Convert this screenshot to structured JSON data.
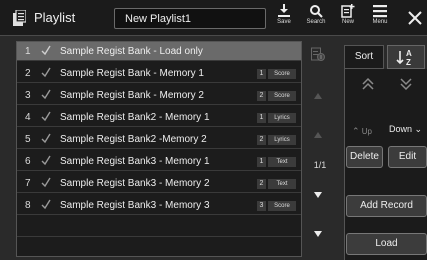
{
  "header": {
    "title": "Playlist",
    "playlist_name": "New Playlist1",
    "tools": [
      {
        "label": "Save",
        "icon": "save-icon"
      },
      {
        "label": "Search",
        "icon": "search-icon"
      },
      {
        "label": "New",
        "icon": "new-icon"
      },
      {
        "label": "Menu",
        "icon": "menu-icon"
      }
    ]
  },
  "list": {
    "rows": [
      {
        "num": "1",
        "name": "Sample Regist Bank - Load only",
        "memory": "",
        "type": ""
      },
      {
        "num": "2",
        "name": "Sample Regist Bank - Memory 1",
        "memory": "1",
        "type": "Score"
      },
      {
        "num": "3",
        "name": "Sample Regist Bank - Memory 2",
        "memory": "2",
        "type": "Score"
      },
      {
        "num": "4",
        "name": "Sample Regist Bank2 - Memory 1",
        "memory": "1",
        "type": "Lyrics"
      },
      {
        "num": "5",
        "name": "Sample Regist Bank2 -Memory 2",
        "memory": "2",
        "type": "Lyrics"
      },
      {
        "num": "6",
        "name": "Sample Regist Bank3 - Memory 1",
        "memory": "1",
        "type": "Text"
      },
      {
        "num": "7",
        "name": "Sample Regist Bank3 - Memory 2",
        "memory": "2",
        "type": "Text"
      },
      {
        "num": "8",
        "name": "Sample Regist Bank3 - Memory 3",
        "memory": "3",
        "type": "Score"
      }
    ]
  },
  "pager": {
    "page": "1/1"
  },
  "sort": {
    "label": "Sort",
    "az_top": "A",
    "az_bottom": "Z"
  },
  "move": {
    "up_label": "Up",
    "direction": "Down"
  },
  "buttons": {
    "delete": "Delete",
    "edit": "Edit",
    "add_record": "Add Record",
    "load": "Load"
  },
  "colors": {
    "background": "#2a2a2a",
    "selected_row": "#6a6a6a",
    "list_bg": "#1c1c1c"
  }
}
